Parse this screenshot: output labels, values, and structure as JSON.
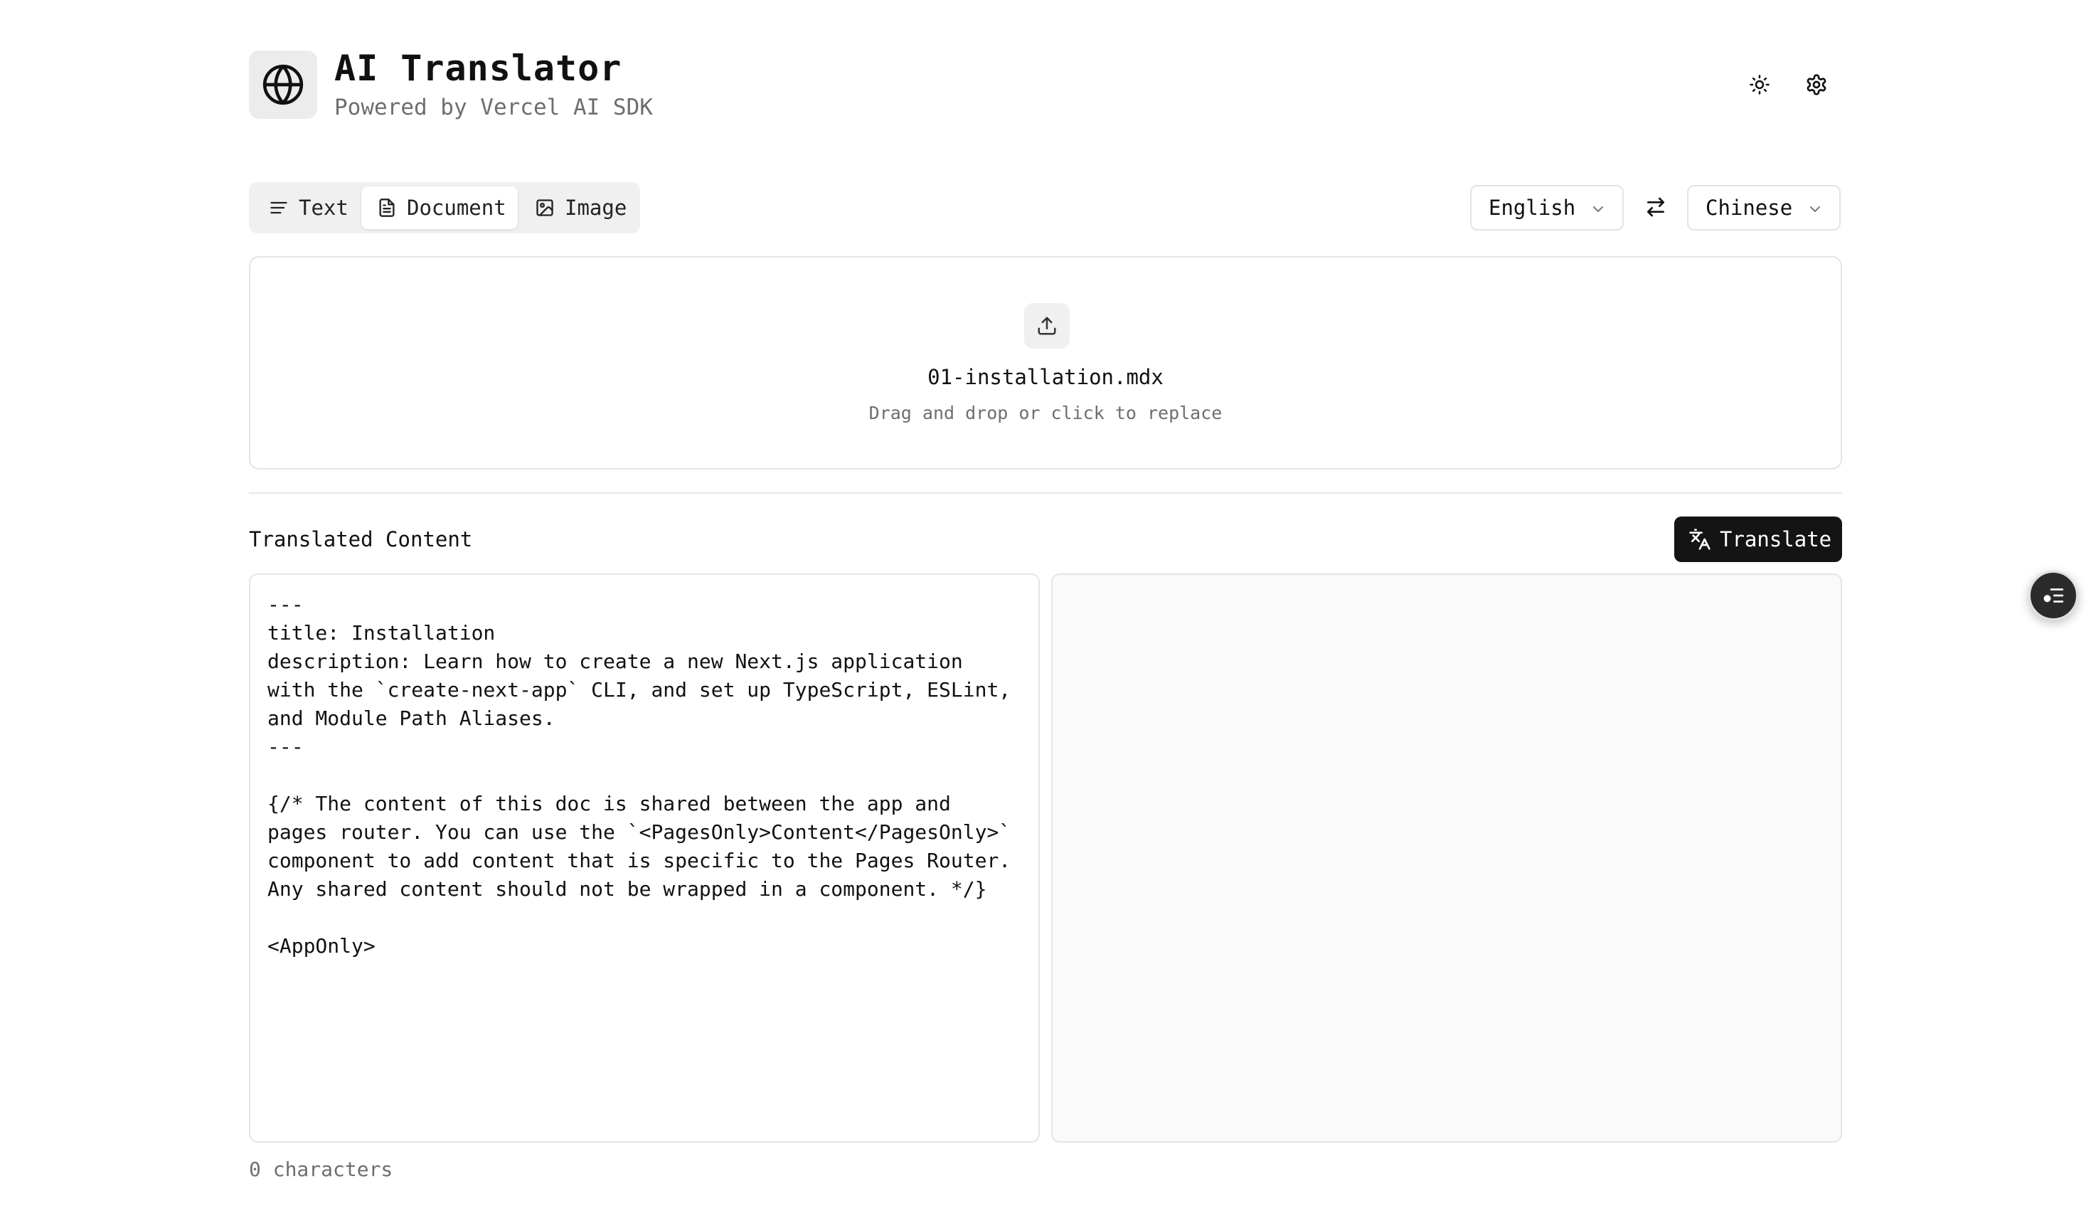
{
  "header": {
    "title": "AI Translator",
    "subtitle": "Powered by Vercel AI SDK",
    "logo_icon": "globe-icon",
    "theme_icon": "sun-icon",
    "settings_icon": "gear-icon"
  },
  "mode_tabs": {
    "items": [
      {
        "label": "Text",
        "icon": "text-lines-icon",
        "active": false
      },
      {
        "label": "Document",
        "icon": "document-icon",
        "active": true
      },
      {
        "label": "Image",
        "icon": "image-icon",
        "active": false
      }
    ]
  },
  "languages": {
    "source": "English",
    "target": "Chinese",
    "swap_icon": "swap-arrows-icon"
  },
  "upload": {
    "filename": "01-installation.mdx",
    "hint": "Drag and drop or click to replace",
    "icon": "upload-icon"
  },
  "output": {
    "section_title": "Translated Content",
    "translate_label": "Translate",
    "translate_icon": "translate-icon",
    "source_text": "---\ntitle: Installation\ndescription: Learn how to create a new Next.js application with the `create-next-app` CLI, and set up TypeScript, ESLint, and Module Path Aliases.\n---\n\n{/* The content of this doc is shared between the app and pages router. You can use the `<PagesOnly>Content</PagesOnly>` component to add content that is specific to the Pages Router. Any shared content should not be wrapped in a component. */}\n\n<AppOnly>",
    "char_count": "0 characters"
  },
  "fab": {
    "icon": "assistant-list-icon"
  },
  "colors": {
    "accent": "#141414",
    "muted_text": "#6e6e6e",
    "border": "#e4e4e4",
    "tab_bg": "#f0f0f0"
  }
}
